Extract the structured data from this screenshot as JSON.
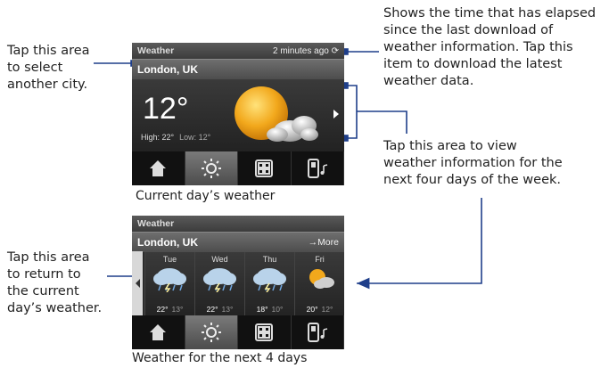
{
  "annotations": {
    "select_city": [
      "Tap this area",
      "to select",
      "another city."
    ],
    "elapsed": [
      "Shows the time that has elapsed",
      "since the last download of",
      "weather information. Tap this",
      "item to download the latest",
      "weather data."
    ],
    "four_days": [
      "Tap this area to view",
      "weather information for the",
      "next four days of the week."
    ],
    "return": [
      "Tap this area",
      "to return to",
      "the current",
      "day’s weather."
    ]
  },
  "captions": {
    "current": "Current day’s weather",
    "next": "Weather for the next 4 days"
  },
  "widget_current": {
    "title": "Weather",
    "age": "2 minutes ago",
    "city": "London, UK",
    "temp": "12°",
    "high": "High: 22°",
    "low": "Low: 12°"
  },
  "widget_forecast": {
    "title": "Weather",
    "city": "London, UK",
    "more": "→More",
    "days": [
      {
        "name": "Tue",
        "high": "22°",
        "low": "13°",
        "icon": "storm-cloud-icon"
      },
      {
        "name": "Wed",
        "high": "22°",
        "low": "13°",
        "icon": "storm-cloud-icon"
      },
      {
        "name": "Thu",
        "high": "18°",
        "low": "10°",
        "icon": "storm-cloud-icon"
      },
      {
        "name": "Fri",
        "high": "20°",
        "low": "12°",
        "icon": "sun-cloud-icon"
      }
    ]
  },
  "tabs": [
    "home-icon",
    "sun-icon",
    "grid-icon",
    "phone-music-icon"
  ],
  "colors": {
    "accent_line": "#1f3f8a",
    "widget_bg": "#2b2b2b",
    "sun": "#f2a81c"
  }
}
